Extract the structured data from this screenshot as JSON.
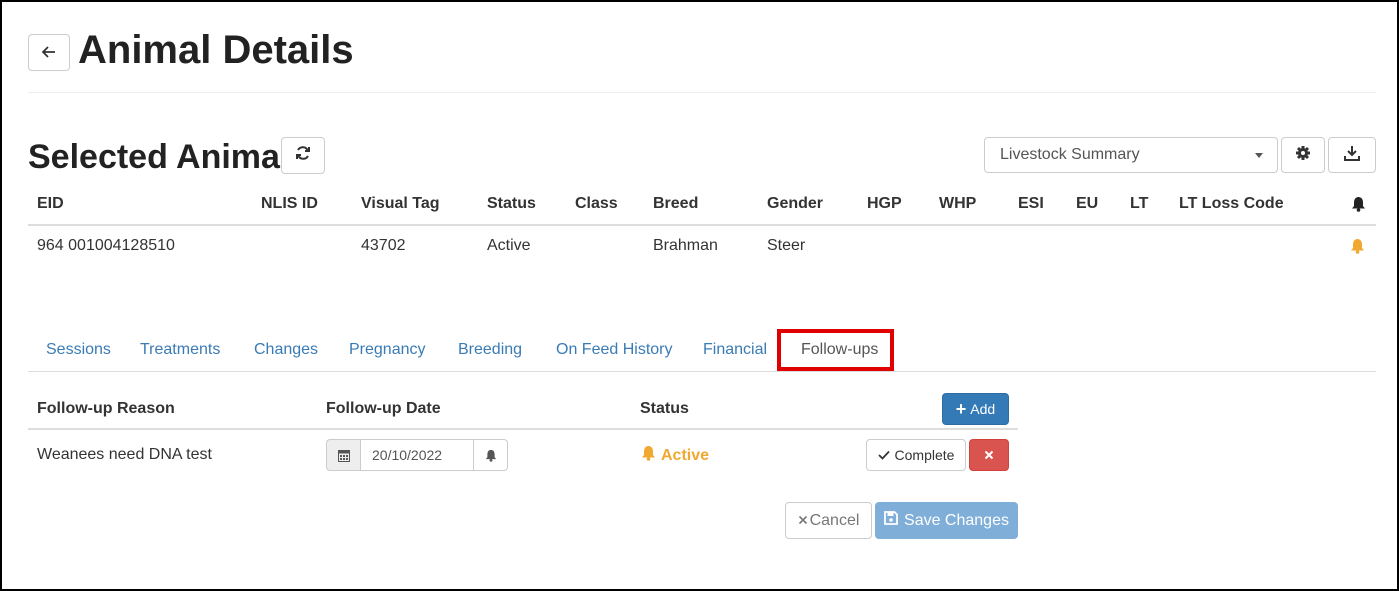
{
  "page": {
    "title": "Animal Details",
    "back_icon": "arrow-left-icon"
  },
  "section": {
    "title": "Selected Animal",
    "refresh_icon": "refresh-icon"
  },
  "summary": {
    "selected": "Livestock Summary",
    "settings_icon": "gear-icon",
    "download_icon": "download-icon"
  },
  "animal_table": {
    "headers": [
      "EID",
      "NLIS ID",
      "Visual Tag",
      "Status",
      "Class",
      "Breed",
      "Gender",
      "HGP",
      "WHP",
      "ESI",
      "EU",
      "LT",
      "LT Loss Code"
    ],
    "row": {
      "eid": "964 001004128510",
      "nlis_id": "",
      "visual_tag": "43702",
      "status": "Active",
      "class": "",
      "breed": "Brahman",
      "gender": "Steer",
      "hgp": "",
      "whp": "",
      "esi": "",
      "eu": "",
      "lt": "",
      "lt_loss_code": ""
    }
  },
  "tabs": [
    "Sessions",
    "Treatments",
    "Changes",
    "Pregnancy",
    "Breeding",
    "On Feed History",
    "Financial",
    "Follow-ups"
  ],
  "active_tab": "Follow-ups",
  "followups": {
    "headers": [
      "Follow-up Reason",
      "Follow-up Date",
      "Status"
    ],
    "add_label": "Add",
    "rows": [
      {
        "reason": "Weanees need DNA test",
        "date": "20/10/2022",
        "status": "Active",
        "complete_label": "Complete"
      }
    ]
  },
  "actions": {
    "cancel_label": "Cancel",
    "save_label": "Save Changes"
  },
  "colors": {
    "link": "#3a7bb5",
    "primary": "#337ab7",
    "danger": "#d9534f",
    "warning": "#f0a830",
    "highlight": "#e00000"
  }
}
